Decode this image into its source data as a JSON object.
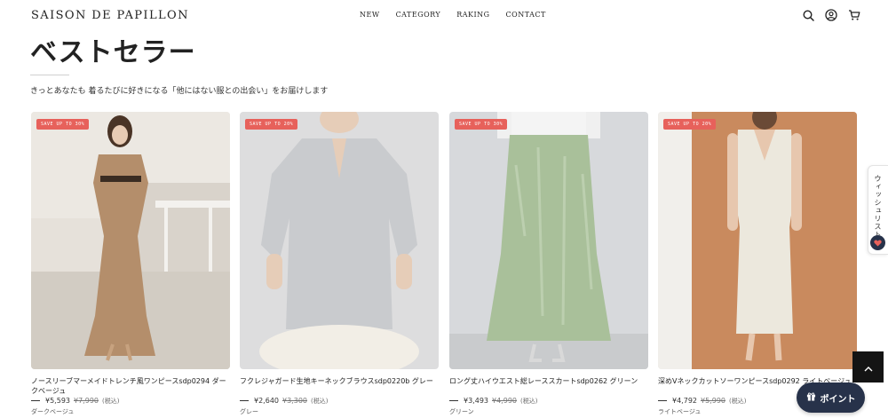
{
  "header": {
    "logo": "SAISON DE PAPILLON",
    "nav": [
      "NEW",
      "CATEGORY",
      "RAKING",
      "CONTACT"
    ],
    "icons": [
      "search-icon",
      "account-icon",
      "cart-icon"
    ]
  },
  "section": {
    "title": "ベストセラー",
    "subtitle": "きっとあなたも 着るたびに好きになる「他にはない服との出会い」をお届けします"
  },
  "products": [
    {
      "badge": "SAVE UP TO 30%",
      "name": "ノースリーブマーメイドトレンチ風ワンピースsdp0294 ダークベージュ",
      "price": "¥5,593",
      "old_price": "¥7,990",
      "tax": "(税込)",
      "color": "ダークベージュ"
    },
    {
      "badge": "SAVE UP TO 20%",
      "name": "フクレジャガード生地キーネックブラウスsdp0220b グレー",
      "price": "¥2,640",
      "old_price": "¥3,300",
      "tax": "(税込)",
      "color": "グレー"
    },
    {
      "badge": "SAVE UP TO 30%",
      "name": "ロング丈ハイウエスト総レーススカートsdp0262 グリーン",
      "price": "¥3,493",
      "old_price": "¥4,990",
      "tax": "(税込)",
      "color": "グリーン"
    },
    {
      "badge": "SAVE UP TO 20%",
      "name": "深めVネックカットソーワンピースsdp0292 ライトベージュ",
      "price": "¥4,792",
      "old_price": "¥5,990",
      "tax": "(税込)",
      "color": "ライトベージュ"
    }
  ],
  "wishlist_tab": {
    "label": "ウィッシュリスト"
  },
  "points_button": {
    "label": "ポイント"
  },
  "colors": {
    "badge": "#e7615b",
    "navy": "#27324a",
    "scroll_top": "#141414"
  }
}
